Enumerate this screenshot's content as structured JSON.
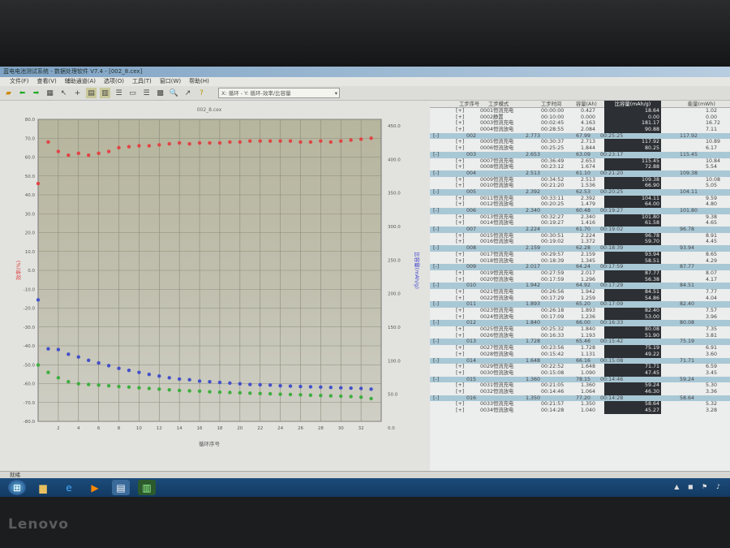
{
  "window": {
    "title": "蓝电电池测试系统 - 数据处理软件 V7.4 - [002_8.cex]"
  },
  "menu": [
    "文件(F)",
    "查看(V)",
    "辅助通道(A)",
    "选项(O)",
    "工具(T)",
    "窗口(W)",
    "帮助(H)"
  ],
  "toolbar": {
    "icons": [
      "open-icon",
      "back-arrow-icon",
      "forward-arrow-icon",
      "table-icon",
      "zoom-icon",
      "arrow-icon",
      "help-icon"
    ],
    "combo_value": "X: 循环 - Y: 循环-效率/比容量"
  },
  "status": {
    "text": "就绪"
  },
  "brand": {
    "logo": "Lenovo"
  },
  "colors": {
    "efficiency": "#e04545",
    "charge": "#4450c8",
    "discharge": "#3fae3f",
    "plot_bg": "#bcbba6",
    "group_row": "#a9c8d6"
  },
  "chart_data": {
    "type": "scatter",
    "title": "002_8.cex",
    "xlabel": "循环序号",
    "ylabel_left": "效率(%)",
    "ylabel_right": "比容量(mAh/g)",
    "xlim": [
      0,
      34
    ],
    "ylim_left": [
      -80,
      80
    ],
    "ylim_right": [
      0,
      450
    ],
    "xticks": [
      2,
      4,
      6,
      8,
      10,
      12,
      14,
      16,
      18,
      20,
      22,
      24,
      26,
      28,
      30,
      32
    ],
    "yticks_left": [
      "80.0",
      "70.0",
      "60.0",
      "50.0",
      "40.0",
      "30.0",
      "20.0",
      "10.0",
      "0.0",
      "-10.0",
      "-20.0",
      "-30.0",
      "-40.0",
      "-50.0",
      "-60.0",
      "-70.0",
      "-80.0"
    ],
    "yticks_right": [
      "450.0",
      "400.0",
      "350.0",
      "300.0",
      "250.0",
      "200.0",
      "150.0",
      "100.0",
      "50.0",
      "0.0"
    ],
    "grid": true,
    "x": [
      0,
      1,
      2,
      3,
      4,
      5,
      6,
      7,
      8,
      9,
      10,
      11,
      12,
      13,
      14,
      15,
      16,
      17,
      18,
      19,
      20,
      21,
      22,
      23,
      24,
      25,
      26,
      27,
      28,
      29,
      30,
      31,
      32,
      33
    ],
    "series": [
      {
        "axis": "left",
        "color": "#e04545",
        "values": [
          46,
          68,
          63,
          61,
          62,
          61,
          62,
          63,
          65,
          65.5,
          66,
          66,
          66.5,
          67,
          67.5,
          67,
          67.5,
          67.5,
          67.5,
          68,
          68,
          68.5,
          68.5,
          68.5,
          68.5,
          68.5,
          68,
          68,
          68.5,
          68,
          68.5,
          69,
          69.5,
          70
        ]
      },
      {
        "axis": "right",
        "color": "#4450c8",
        "values": [
          181,
          108,
          107,
          100,
          96,
          91,
          87,
          83,
          79,
          76,
          73,
          70,
          67.5,
          65,
          63,
          62,
          60,
          59,
          58,
          57,
          56,
          55,
          54.5,
          54,
          53,
          52.5,
          52,
          51.5,
          51,
          50.5,
          50,
          49.5,
          49,
          48
        ]
      },
      {
        "axis": "right",
        "color": "#3fae3f",
        "values": [
          84,
          73,
          65,
          59,
          56,
          55,
          54,
          53,
          52,
          51,
          50,
          49,
          48,
          47,
          46,
          45.5,
          45,
          44,
          43.5,
          43,
          42.5,
          42,
          41.5,
          41,
          40.5,
          40,
          39.5,
          39,
          38.5,
          38,
          37.5,
          37,
          36,
          34
        ]
      }
    ]
  },
  "table": {
    "headers": [
      "工步序号",
      "工步模式",
      "工步时间",
      "容量(Ah)",
      "比容量(mAh/g)",
      "能量(mWh)"
    ],
    "rows": [
      {
        "t": "s",
        "exp": "[+]",
        "no": "0001",
        "mode": "恒流充电",
        "time": "00:00:00",
        "cap": "0.427",
        "sc": "18.64",
        "en": "1.02"
      },
      {
        "t": "s",
        "exp": "[+]",
        "no": "0002",
        "mode": "静置",
        "time": "00:10:00",
        "cap": "0.000",
        "sc": "0.00",
        "en": "0.00"
      },
      {
        "t": "s",
        "exp": "[+]",
        "no": "0003",
        "mode": "恒流充电",
        "time": "00:02:45",
        "cap": "4.163",
        "sc": "181.17",
        "en": "16.72"
      },
      {
        "t": "s",
        "exp": "[+]",
        "no": "0004",
        "mode": "恒流放电",
        "time": "00:28:55",
        "cap": "2.084",
        "sc": "90.88",
        "en": "7.11"
      },
      {
        "t": "g",
        "exp": "[-]",
        "cyc": "002",
        "cap": "2.773",
        "eff": "67.99",
        "time": "00:25:25",
        "sc": "117.92"
      },
      {
        "t": "s",
        "exp": "[+]",
        "no": "0005",
        "mode": "恒流充电",
        "time": "00:30:37",
        "cap": "2.713",
        "sc": "117.92",
        "en": "10.89"
      },
      {
        "t": "s",
        "exp": "[+]",
        "no": "0006",
        "mode": "恒流放电",
        "time": "00:25:25",
        "cap": "1.844",
        "sc": "80.25",
        "en": "6.17"
      },
      {
        "t": "g",
        "exp": "[-]",
        "cyc": "003",
        "cap": "2.653",
        "eff": "63.09",
        "time": "00:23:17",
        "sc": "115.45"
      },
      {
        "t": "s",
        "exp": "[+]",
        "no": "0007",
        "mode": "恒流充电",
        "time": "00:36:49",
        "cap": "2.653",
        "sc": "115.45",
        "en": "10.84"
      },
      {
        "t": "s",
        "exp": "[+]",
        "no": "0008",
        "mode": "恒流放电",
        "time": "00:23:12",
        "cap": "1.674",
        "sc": "72.88",
        "en": "5.54"
      },
      {
        "t": "g",
        "exp": "[-]",
        "cyc": "004",
        "cap": "2.513",
        "eff": "61.10",
        "time": "00:21:20",
        "sc": "109.38"
      },
      {
        "t": "s",
        "exp": "[+]",
        "no": "0009",
        "mode": "恒流充电",
        "time": "00:34:52",
        "cap": "2.513",
        "sc": "109.38",
        "en": "10.08"
      },
      {
        "t": "s",
        "exp": "[+]",
        "no": "0010",
        "mode": "恒流放电",
        "time": "00:21:20",
        "cap": "1.536",
        "sc": "66.90",
        "en": "5.05"
      },
      {
        "t": "g",
        "exp": "[-]",
        "cyc": "005",
        "cap": "2.392",
        "eff": "62.53",
        "time": "00:20:25",
        "sc": "104.11"
      },
      {
        "t": "s",
        "exp": "[+]",
        "no": "0011",
        "mode": "恒流充电",
        "time": "00:33:11",
        "cap": "2.392",
        "sc": "104.11",
        "en": "9.59"
      },
      {
        "t": "s",
        "exp": "[+]",
        "no": "0012",
        "mode": "恒流放电",
        "time": "00:20:25",
        "cap": "1.479",
        "sc": "64.00",
        "en": "4.80"
      },
      {
        "t": "g",
        "exp": "[-]",
        "cyc": "006",
        "cap": "2.340",
        "eff": "60.48",
        "time": "00:19:27",
        "sc": "101.80"
      },
      {
        "t": "s",
        "exp": "[+]",
        "no": "0013",
        "mode": "恒流充电",
        "time": "00:32:27",
        "cap": "2.340",
        "sc": "101.80",
        "en": "9.38"
      },
      {
        "t": "s",
        "exp": "[+]",
        "no": "0014",
        "mode": "恒流放电",
        "time": "00:19:27",
        "cap": "1.416",
        "sc": "61.58",
        "en": "4.65"
      },
      {
        "t": "g",
        "exp": "[-]",
        "cyc": "007",
        "cap": "2.224",
        "eff": "61.70",
        "time": "00:19:02",
        "sc": "96.78"
      },
      {
        "t": "s",
        "exp": "[+]",
        "no": "0015",
        "mode": "恒流充电",
        "time": "00:30:51",
        "cap": "2.224",
        "sc": "96.78",
        "en": "8.91"
      },
      {
        "t": "s",
        "exp": "[+]",
        "no": "0016",
        "mode": "恒流放电",
        "time": "00:19:02",
        "cap": "1.372",
        "sc": "59.70",
        "en": "4.45"
      },
      {
        "t": "g",
        "exp": "[-]",
        "cyc": "008",
        "cap": "2.159",
        "eff": "62.28",
        "time": "00:18:39",
        "sc": "93.94"
      },
      {
        "t": "s",
        "exp": "[+]",
        "no": "0017",
        "mode": "恒流充电",
        "time": "00:29:57",
        "cap": "2.159",
        "sc": "93.94",
        "en": "8.65"
      },
      {
        "t": "s",
        "exp": "[+]",
        "no": "0018",
        "mode": "恒流放电",
        "time": "00:18:39",
        "cap": "1.345",
        "sc": "58.51",
        "en": "4.29"
      },
      {
        "t": "g",
        "exp": "[-]",
        "cyc": "009",
        "cap": "2.017",
        "eff": "64.24",
        "time": "00:17:59",
        "sc": "87.77"
      },
      {
        "t": "s",
        "exp": "[+]",
        "no": "0019",
        "mode": "恒流充电",
        "time": "00:27:59",
        "cap": "2.017",
        "sc": "87.77",
        "en": "8.07"
      },
      {
        "t": "s",
        "exp": "[+]",
        "no": "0020",
        "mode": "恒流放电",
        "time": "00:17:59",
        "cap": "1.296",
        "sc": "56.38",
        "en": "4.17"
      },
      {
        "t": "g",
        "exp": "[-]",
        "cyc": "010",
        "cap": "1.942",
        "eff": "64.92",
        "time": "00:17:29",
        "sc": "84.51"
      },
      {
        "t": "s",
        "exp": "[+]",
        "no": "0021",
        "mode": "恒流充电",
        "time": "00:26:56",
        "cap": "1.942",
        "sc": "84.51",
        "en": "7.77"
      },
      {
        "t": "s",
        "exp": "[+]",
        "no": "0022",
        "mode": "恒流放电",
        "time": "00:17:29",
        "cap": "1.259",
        "sc": "54.86",
        "en": "4.04"
      },
      {
        "t": "g",
        "exp": "[-]",
        "cyc": "011",
        "cap": "1.893",
        "eff": "65.20",
        "time": "00:17:09",
        "sc": "82.40"
      },
      {
        "t": "s",
        "exp": "[+]",
        "no": "0023",
        "mode": "恒流充电",
        "time": "00:26:18",
        "cap": "1.893",
        "sc": "82.40",
        "en": "7.57"
      },
      {
        "t": "s",
        "exp": "[+]",
        "no": "0024",
        "mode": "恒流放电",
        "time": "00:17:09",
        "cap": "1.236",
        "sc": "53.00",
        "en": "3.96"
      },
      {
        "t": "g",
        "exp": "[-]",
        "cyc": "012",
        "cap": "1.840",
        "eff": "66.00",
        "time": "00:16:33",
        "sc": "80.08"
      },
      {
        "t": "s",
        "exp": "[+]",
        "no": "0025",
        "mode": "恒流充电",
        "time": "00:25:32",
        "cap": "1.840",
        "sc": "80.08",
        "en": "7.35"
      },
      {
        "t": "s",
        "exp": "[+]",
        "no": "0026",
        "mode": "恒流放电",
        "time": "00:16:33",
        "cap": "1.193",
        "sc": "51.90",
        "en": "3.81"
      },
      {
        "t": "g",
        "exp": "[-]",
        "cyc": "013",
        "cap": "1.728",
        "eff": "65.46",
        "time": "00:15:42",
        "sc": "75.19"
      },
      {
        "t": "s",
        "exp": "[+]",
        "no": "0027",
        "mode": "恒流充电",
        "time": "00:23:56",
        "cap": "1.728",
        "sc": "75.19",
        "en": "6.91"
      },
      {
        "t": "s",
        "exp": "[+]",
        "no": "0028",
        "mode": "恒流放电",
        "time": "00:15:42",
        "cap": "1.131",
        "sc": "49.22",
        "en": "3.60"
      },
      {
        "t": "g",
        "exp": "[-]",
        "cyc": "014",
        "cap": "1.648",
        "eff": "66.16",
        "time": "00:15:08",
        "sc": "71.71"
      },
      {
        "t": "s",
        "exp": "[+]",
        "no": "0029",
        "mode": "恒流充电",
        "time": "00:22:52",
        "cap": "1.648",
        "sc": "71.71",
        "en": "6.59"
      },
      {
        "t": "s",
        "exp": "[+]",
        "no": "0030",
        "mode": "恒流放电",
        "time": "00:15:08",
        "cap": "1.090",
        "sc": "47.45",
        "en": "3.45"
      },
      {
        "t": "g",
        "exp": "[-]",
        "cyc": "015",
        "cap": "1.360",
        "eff": "78.15",
        "time": "00:14:46",
        "sc": "59.24"
      },
      {
        "t": "s",
        "exp": "[+]",
        "no": "0031",
        "mode": "恒流充电",
        "time": "00:21:05",
        "cap": "1.360",
        "sc": "59.24",
        "en": "5.30"
      },
      {
        "t": "s",
        "exp": "[+]",
        "no": "0032",
        "mode": "恒流放电",
        "time": "00:14:46",
        "cap": "1.064",
        "sc": "46.30",
        "en": "3.36"
      },
      {
        "t": "g",
        "exp": "[-]",
        "cyc": "016",
        "cap": "1.350",
        "eff": "77.20",
        "time": "00:14:28",
        "sc": "58.64"
      },
      {
        "t": "s",
        "exp": "[+]",
        "no": "0033",
        "mode": "恒流充电",
        "time": "00:21:57",
        "cap": "1.350",
        "sc": "58.64",
        "en": "5.32"
      },
      {
        "t": "s",
        "exp": "[+]",
        "no": "0034",
        "mode": "恒流放电",
        "time": "00:14:28",
        "cap": "1.040",
        "sc": "45.27",
        "en": "3.28"
      }
    ]
  }
}
